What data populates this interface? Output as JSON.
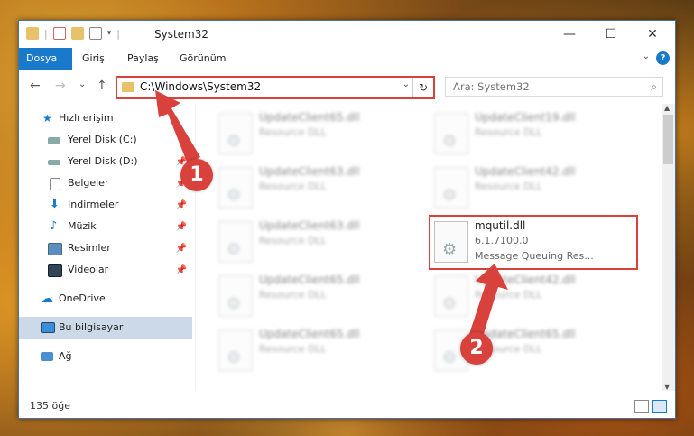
{
  "window": {
    "title": "System32",
    "minimize_glyph": "—",
    "maximize_glyph": "☐",
    "close_glyph": "✕"
  },
  "ribbon": {
    "tabs": [
      "Dosya",
      "Giriş",
      "Paylaş",
      "Görünüm"
    ],
    "active_tab": "Dosya",
    "help_label": "?"
  },
  "nav": {
    "back_glyph": "←",
    "forward_glyph": "→",
    "recent_glyph": "⌄",
    "up_glyph": "↑",
    "address": "C:\\Windows\\System32",
    "refresh_glyph": "↻",
    "search_placeholder": "Ara: System32"
  },
  "sidebar": {
    "items": [
      {
        "label": "Hızlı erişim",
        "icon": "star-icon"
      },
      {
        "label": "Yerel Disk (C:)",
        "icon": "drive-icon"
      },
      {
        "label": "Yerel Disk (D:)",
        "icon": "drive-icon"
      },
      {
        "label": "Belgeler",
        "icon": "documents-icon"
      },
      {
        "label": "İndirmeler",
        "icon": "download-icon"
      },
      {
        "label": "Müzik",
        "icon": "music-icon"
      },
      {
        "label": "Resimler",
        "icon": "pictures-icon"
      },
      {
        "label": "Videolar",
        "icon": "videos-icon"
      },
      {
        "label": "OneDrive",
        "icon": "cloud-icon"
      },
      {
        "label": "Bu bilgisayar",
        "icon": "computer-icon"
      },
      {
        "label": "Ağ",
        "icon": "network-icon"
      }
    ],
    "selected": "Bu bilgisayar"
  },
  "files": [
    {
      "name": "UpdateClient65.dll",
      "type": "Resource DLL"
    },
    {
      "name": "UpdateClient19.dll",
      "type": "Resource DLL"
    },
    {
      "name": "UpdateClient63.dll",
      "type": "Resource DLL"
    },
    {
      "name": "UpdateClient42.dll",
      "type": "Resource DLL"
    },
    {
      "name": "UpdateClient63.dll",
      "type": "Resource DLL"
    },
    {
      "name": "mqutil.dll",
      "version": "6.1.7100.0",
      "type": "Message Queuing Res..."
    },
    {
      "name": "UpdateClient65.dll",
      "type": "Resource DLL"
    },
    {
      "name": "UpdateClient42.dll",
      "type": "Resource DLL"
    },
    {
      "name": "UpdateClient65.dll",
      "type": "Resource DLL"
    },
    {
      "name": "UpdateClient65.dll",
      "type": "Resource DLL"
    }
  ],
  "status": {
    "item_count": "135 öğe"
  },
  "annotations": {
    "marker1": "1",
    "marker2": "2",
    "color": "#d9413d"
  },
  "colors": {
    "accent": "#1979ca",
    "highlight": "#d9413d",
    "selected_bg": "#ccd9e8"
  }
}
